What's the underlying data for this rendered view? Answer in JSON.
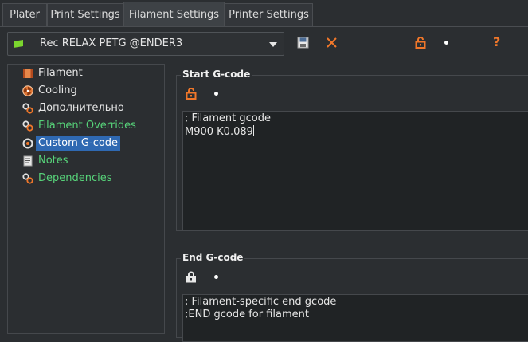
{
  "tabs": [
    {
      "label": "Plater",
      "active": false
    },
    {
      "label": "Print Settings",
      "active": false
    },
    {
      "label": "Filament Settings",
      "active": true
    },
    {
      "label": "Printer Settings",
      "active": false
    }
  ],
  "preset": {
    "name": "Rec RELAX PETG @ENDER3",
    "flag_color": "#7bd62e"
  },
  "toolbar": {
    "save_icon": "save-icon",
    "delete_icon": "close-x-icon",
    "unlock_icon": "unlock-icon",
    "dot_icon": "bullet-icon",
    "help_label": "?"
  },
  "tree": {
    "items": [
      {
        "label": "Filament",
        "icon": "spool-icon",
        "state": "normal"
      },
      {
        "label": "Cooling",
        "icon": "fan-icon",
        "state": "normal"
      },
      {
        "label": "Дополнительно",
        "icon": "gears-icon",
        "state": "normal"
      },
      {
        "label": "Filament Overrides",
        "icon": "gears-icon",
        "state": "modified"
      },
      {
        "label": "Custom G-code",
        "icon": "gcode-icon",
        "state": "selected"
      },
      {
        "label": "Notes",
        "icon": "notes-icon",
        "state": "modified"
      },
      {
        "label": "Dependencies",
        "icon": "gears-icon",
        "state": "modified"
      }
    ]
  },
  "start_gcode": {
    "title": "Start G-code",
    "lines": [
      "; Filament gcode",
      "M900 K0.089"
    ]
  },
  "end_gcode": {
    "title": "End G-code",
    "lines": [
      "; Filament-specific end gcode",
      ";END gcode for filament"
    ]
  },
  "colors": {
    "accent_orange": "#f0772a",
    "modified_green": "#57d47a",
    "selection_blue": "#2f69b2"
  }
}
